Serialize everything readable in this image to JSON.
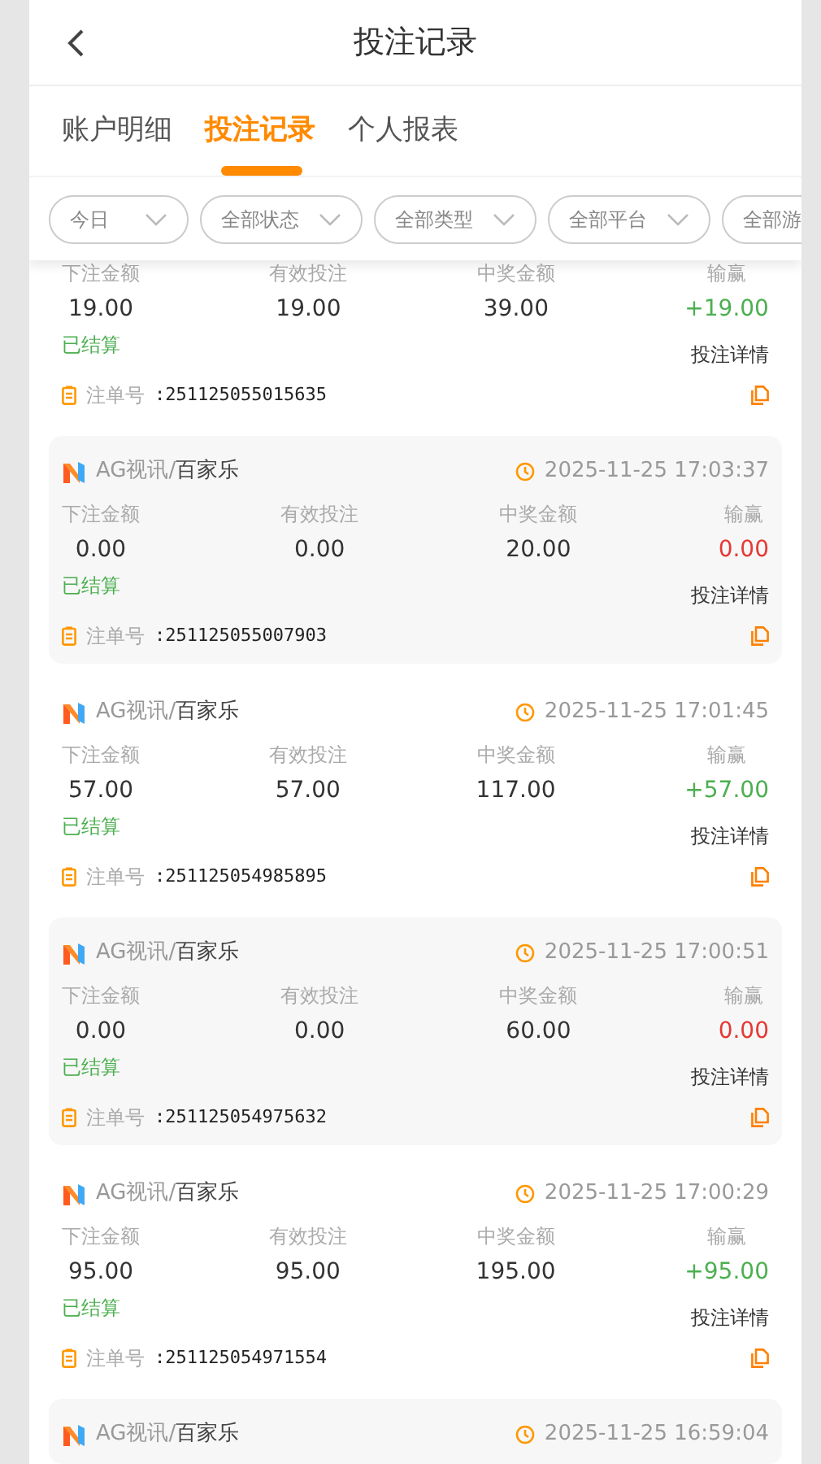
{
  "header": {
    "title": "投注记录"
  },
  "tabs": [
    {
      "label": "账户明细",
      "selected": false
    },
    {
      "label": "投注记录",
      "selected": true
    },
    {
      "label": "个人报表",
      "selected": false
    }
  ],
  "filters": [
    "今日",
    "全部状态",
    "全部类型",
    "全部平台",
    "全部游"
  ],
  "records": [
    {
      "labels": [
        "下注金额",
        "有效投注",
        "中奖金额",
        "输赢"
      ],
      "stake": "19.00",
      "valid": "19.00",
      "payout": "39.00",
      "result": "+19.00",
      "kind": "win",
      "status": "已结算",
      "detail": "投注详情",
      "order_label": "注单号",
      "order_no": ":251125055015635"
    },
    {
      "platform": "AG视讯",
      "separator": "/",
      "game": "百家乐",
      "time": "2025-11-25 17:03:37",
      "labels": [
        "下注金额",
        "有效投注",
        "中奖金额",
        "输赢"
      ],
      "stake": "0.00",
      "valid": "0.00",
      "payout": "20.00",
      "result": "0.00",
      "kind": "loss",
      "status": "已结算",
      "detail": "投注详情",
      "order_label": "注单号",
      "order_no": ":251125055007903"
    },
    {
      "platform": "AG视讯",
      "separator": "/",
      "game": "百家乐",
      "time": "2025-11-25 17:01:45",
      "labels": [
        "下注金额",
        "有效投注",
        "中奖金额",
        "输赢"
      ],
      "stake": "57.00",
      "valid": "57.00",
      "payout": "117.00",
      "result": "+57.00",
      "kind": "win",
      "status": "已结算",
      "detail": "投注详情",
      "order_label": "注单号",
      "order_no": ":251125054985895"
    },
    {
      "platform": "AG视讯",
      "separator": "/",
      "game": "百家乐",
      "time": "2025-11-25 17:00:51",
      "labels": [
        "下注金额",
        "有效投注",
        "中奖金额",
        "输赢"
      ],
      "stake": "0.00",
      "valid": "0.00",
      "payout": "60.00",
      "result": "0.00",
      "kind": "loss",
      "status": "已结算",
      "detail": "投注详情",
      "order_label": "注单号",
      "order_no": ":251125054975632"
    },
    {
      "platform": "AG视讯",
      "separator": "/",
      "game": "百家乐",
      "time": "2025-11-25 17:00:29",
      "labels": [
        "下注金额",
        "有效投注",
        "中奖金额",
        "输赢"
      ],
      "stake": "95.00",
      "valid": "95.00",
      "payout": "195.00",
      "result": "+95.00",
      "kind": "win",
      "status": "已结算",
      "detail": "投注详情",
      "order_label": "注单号",
      "order_no": ":251125054971554"
    },
    {
      "platform": "AG视讯",
      "separator": "/",
      "game": "百家乐",
      "time": "2025-11-25 16:59:04"
    }
  ]
}
